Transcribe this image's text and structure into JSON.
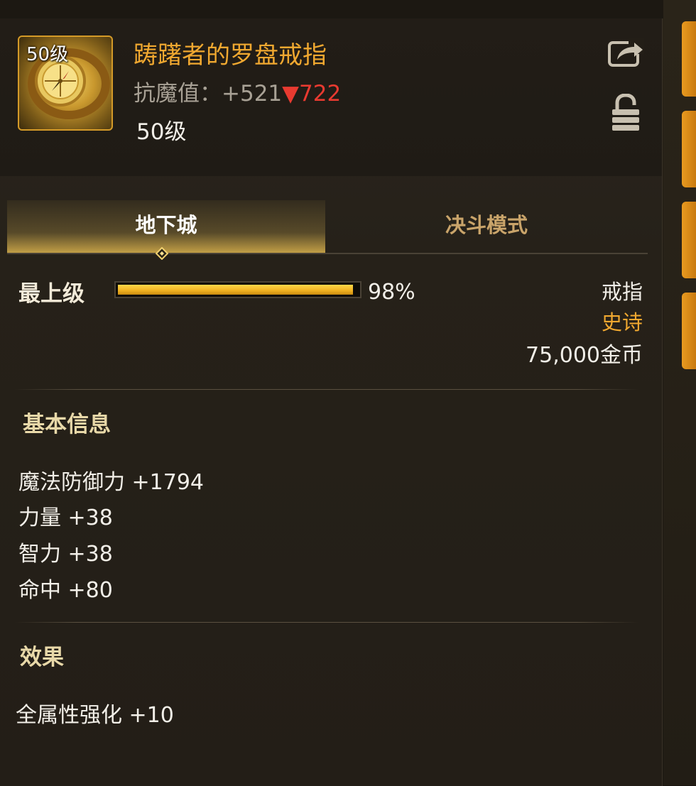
{
  "item": {
    "icon_level": "50级",
    "name": "踌躇者的罗盘戒指",
    "resist_label": "抗魔值：",
    "resist_value": "+521",
    "resist_diff": "▼722",
    "level": "50级"
  },
  "tabs": [
    {
      "label": "地下城",
      "active": true
    },
    {
      "label": "决斗模式",
      "active": false
    }
  ],
  "grade": {
    "label": "最上级",
    "percent_text": "98%",
    "fill_fraction": 0.98
  },
  "meta": {
    "type": "戒指",
    "rarity": "史诗",
    "price": "75,000金币"
  },
  "basic_info": {
    "title": "基本信息",
    "stats": [
      "魔法防御力 +1794",
      "力量 +38",
      "智力 +38",
      "命中 +80"
    ]
  },
  "effects": {
    "title": "效果",
    "lines": [
      "全属性强化 +10"
    ]
  },
  "colors": {
    "item_name": "#f0a830",
    "rarity_epic": "#f0a830",
    "resist_down": "#e83a30",
    "grade_bar": "#f0b020"
  },
  "icons": [
    "share-icon",
    "lock-icon",
    "ring-item-icon",
    "tab-diamond-marker"
  ]
}
